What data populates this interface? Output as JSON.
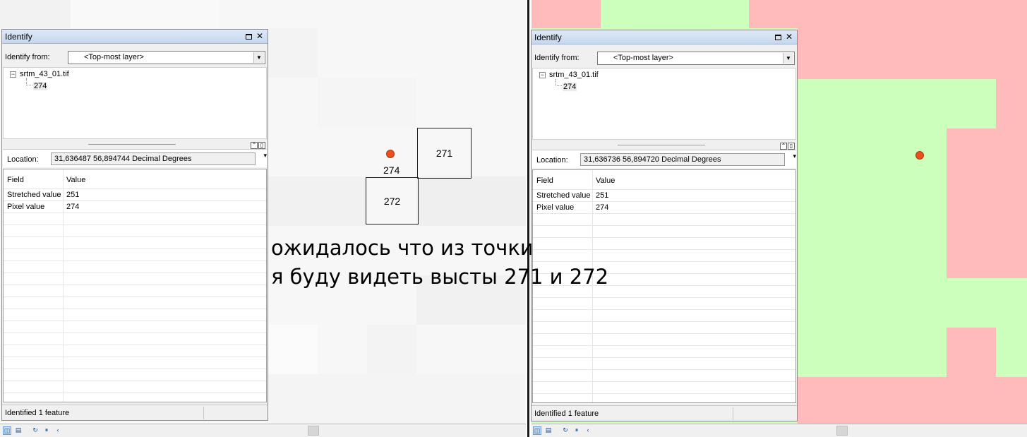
{
  "identify_windows": [
    {
      "title": "Identify",
      "identify_from_label": "Identify from:",
      "identify_from_value": "<Top-most layer>",
      "tree_layer": "srtm_43_01.tif",
      "tree_value": "274",
      "location_label": "Location:",
      "location_value": "31,636487  56,894744 Decimal Degrees",
      "columns": {
        "field": "Field",
        "value": "Value"
      },
      "rows": [
        {
          "field": "Stretched value",
          "value": "251"
        },
        {
          "field": "Pixel value",
          "value": "274"
        }
      ],
      "status": "Identified 1 feature"
    },
    {
      "title": "Identify",
      "identify_from_label": "Identify from:",
      "identify_from_value": "<Top-most layer>",
      "tree_layer": "srtm_43_01.tif",
      "tree_value": "274",
      "location_label": "Location:",
      "location_value": "31,636736  56,894720 Decimal Degrees",
      "columns": {
        "field": "Field",
        "value": "Value"
      },
      "rows": [
        {
          "field": "Stretched value",
          "value": "251"
        },
        {
          "field": "Pixel value",
          "value": "274"
        }
      ],
      "status": "Identified 1 feature"
    }
  ],
  "annotations": {
    "point_label": "274",
    "box_upper": "271",
    "box_lower": "272",
    "caption_line1": "ожидалось что из точки",
    "caption_line2": "я буду видеть высты 271 и 272"
  },
  "icons": {
    "maximize": "window-maximize-icon",
    "close": "close-icon",
    "collapse": "tree-collapse-icon",
    "dropdown": "chevron-down-icon"
  },
  "colors": {
    "map_green": "#ccffbb",
    "map_red": "#ffbbbb",
    "point": "#e8501e",
    "title_bar": "#c6d8ee"
  }
}
